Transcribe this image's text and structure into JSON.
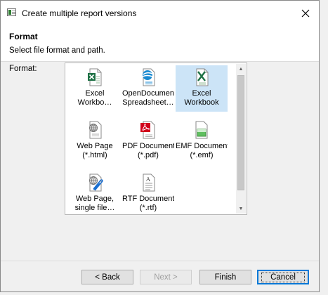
{
  "window": {
    "title": "Create multiple report versions"
  },
  "header": {
    "section_title": "Format",
    "description": "Select file format and path."
  },
  "format_label": "Format:",
  "formats": [
    {
      "line1": "Excel",
      "line2": "Workbo…",
      "icon": "excel-icon",
      "selected": false
    },
    {
      "line1": "OpenDocument",
      "line2": "Spreadsheet…",
      "icon": "opendocument-spreadsheet-icon",
      "selected": false
    },
    {
      "line1": "Excel",
      "line2": "Workbook",
      "icon": "excel-icon",
      "selected": true
    },
    {
      "line1": "Web Page",
      "line2": "(*.html)",
      "icon": "web-page-icon",
      "selected": false
    },
    {
      "line1": "PDF Document",
      "line2": "(*.pdf)",
      "icon": "pdf-icon",
      "selected": false
    },
    {
      "line1": "EMF Document",
      "line2": "(*.emf)",
      "icon": "emf-icon",
      "selected": false
    },
    {
      "line1": "Web Page,",
      "line2": "single file…",
      "icon": "web-page-single-file-icon",
      "selected": false
    },
    {
      "line1": "RTF Document",
      "line2": "(*.rtf)",
      "icon": "rtf-icon",
      "selected": false
    }
  ],
  "buttons": {
    "back": "< Back",
    "next": "Next >",
    "finish": "Finish",
    "cancel": "Cancel"
  },
  "colors": {
    "selection": "#cce4f7",
    "excel_green": "#1e7145",
    "pdf_red": "#d0021b",
    "accent": "#0078d7"
  }
}
